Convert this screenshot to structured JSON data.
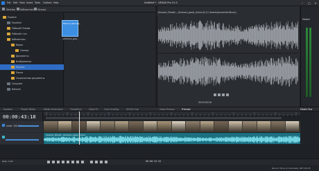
{
  "app": {
    "title": "Untitled * - VEGAS Pro 21.0",
    "menu": [
      "File",
      "Edit",
      "View",
      "Insert",
      "Tools",
      "Options",
      "Help"
    ]
  },
  "explorer": {
    "toolbar_labels": [
      "Desktop",
      "Библиотеки",
      "Музыка"
    ],
    "tree": [
      {
        "label": "Explorer",
        "indent": 0,
        "icon": "folder"
      },
      {
        "label": "Favorites",
        "indent": 1,
        "icon": "star"
      },
      {
        "label": "Рабочий Планов",
        "indent": 1,
        "icon": "folder"
      },
      {
        "label": "Рабочий стол",
        "indent": 1,
        "icon": "folder"
      },
      {
        "label": "Библиотеки",
        "indent": 1,
        "icon": "folder"
      },
      {
        "label": "Видео",
        "indent": 2,
        "icon": "folder"
      },
      {
        "label": "Снимки",
        "indent": 3,
        "icon": "folder"
      },
      {
        "label": "Документы",
        "indent": 2,
        "icon": "folder"
      },
      {
        "label": "Изображения",
        "indent": 2,
        "icon": "folder"
      },
      {
        "label": "Музыка",
        "indent": 2,
        "icon": "folder",
        "selected": true
      },
      {
        "label": "Папки",
        "indent": 2,
        "icon": "folder"
      },
      {
        "label": "Сохраненные документы",
        "indent": 2,
        "icon": "folder"
      },
      {
        "label": "Computer",
        "indent": 1,
        "icon": "computer"
      },
      {
        "label": "Network",
        "indent": 1,
        "icon": "network"
      }
    ],
    "file": {
      "name": "_Khomeni_goal_",
      "thumb_label": "Baboom_Remodel_"
    }
  },
  "trimmer": {
    "path": "Alcaonic_Rhodd..._Khomeni_goals_Unturny2 [C:\\Users\\Aprecenter\\Music]",
    "time": "00:03:43:18"
  },
  "master": {
    "label": "Master"
  },
  "tabs": [
    "Explorer",
    "Project Media",
    "Media Generators",
    "Transitions",
    "Video FX",
    "Color Grading",
    "VEGAS Hub",
    "",
    "Video Preview",
    "Trimmer"
  ],
  "active_tab": "Trimmer",
  "master_bus_tab": "Master Bus",
  "timeline": {
    "timecode": "00:00:43:18",
    "video_level": "Level: 100.0 %",
    "clip_label": "Alcaonic_Rhodd.._Khomeni_goals_Unturn",
    "transport_time": "00:00:43:18",
    "rate": "Rate: 0.00",
    "status": "Record Time (2 channels): 807:09:25"
  },
  "colors": {
    "accent": "#2f6cc4",
    "audio": "#1c6f7f",
    "meter": "#2d8a3a"
  }
}
